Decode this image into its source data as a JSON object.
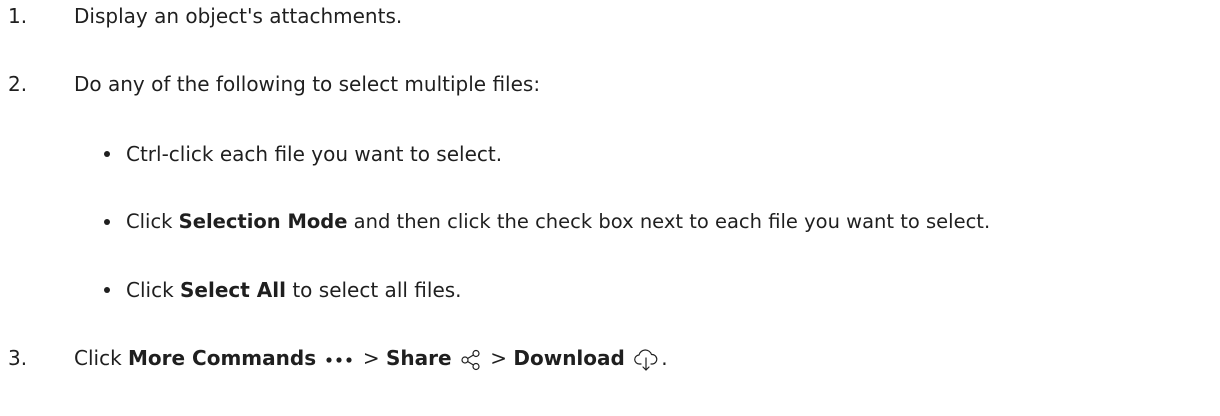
{
  "steps": [
    {
      "number": "1.",
      "text": "Display an object's attachments."
    },
    {
      "number": "2.",
      "text": "Do any of the following to select multiple files:"
    },
    {
      "number": "3."
    }
  ],
  "bullets": {
    "b1": "Ctrl-click each file you want to select.",
    "b2_pre": "Click ",
    "b2_bold": "Selection Mode",
    "b2_post": " and then click the check box next to each file you want to select.",
    "b3_pre": "Click ",
    "b3_bold": "Select All",
    "b3_post": " to select all files."
  },
  "step3": {
    "pre": "Click ",
    "more_commands": "More Commands",
    "sep1": " > ",
    "share": "Share",
    "sep2": " > ",
    "download": "Download",
    "end": "."
  },
  "icons": {
    "more": "more-commands-icon",
    "share": "share-icon",
    "download": "cloud-download-icon"
  }
}
